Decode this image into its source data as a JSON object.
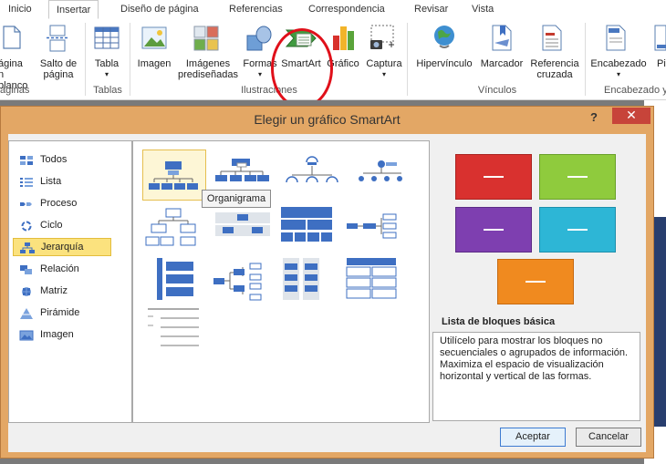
{
  "ribbon": {
    "tabs": [
      "Inicio",
      "Insertar",
      "Diseño de página",
      "Referencias",
      "Correspondencia",
      "Revisar",
      "Vista"
    ],
    "buttons": {
      "pagina_blanco": [
        "ágina",
        "n blanco"
      ],
      "salto_pagina": [
        "Salto de",
        "página"
      ],
      "tabla": "Tabla",
      "imagen": "Imagen",
      "imagenes_pred": [
        "Imágenes",
        "prediseñadas"
      ],
      "formas": "Formas",
      "smartart": "SmartArt",
      "grafico": "Gráfico",
      "captura": "Captura",
      "hipervinculo": "Hipervínculo",
      "marcador": "Marcador",
      "referencia": [
        "Referencia",
        "cruzada"
      ],
      "encabezado": "Encabezado",
      "pie": "Pi"
    },
    "groups": {
      "paginas": "áginas",
      "tablas": "Tablas",
      "ilustraciones": "Ilustraciones",
      "vinculos": "Vínculos",
      "encabezado": "Encabezado y"
    }
  },
  "dialog": {
    "title": "Elegir un gráfico SmartArt",
    "help": "?",
    "close": "✕",
    "categories": [
      "Todos",
      "Lista",
      "Proceso",
      "Ciclo",
      "Jerarquía",
      "Relación",
      "Matriz",
      "Pirámide",
      "Imagen"
    ],
    "selected_category": "Jerarquía",
    "tooltip": "Organigrama",
    "preview_title": "Lista de bloques básica",
    "description": "Utilícelo para mostrar los bloques no secuenciales o agrupados de información. Maximiza el espacio de visualización horizontal y vertical de las formas.",
    "ok_label": "Aceptar",
    "cancel_label": "Cancelar",
    "preview_colors": [
      "#d9312f",
      "#8fcb3d",
      "#7e3fb0",
      "#2db6d6",
      "#f08a1f"
    ]
  }
}
